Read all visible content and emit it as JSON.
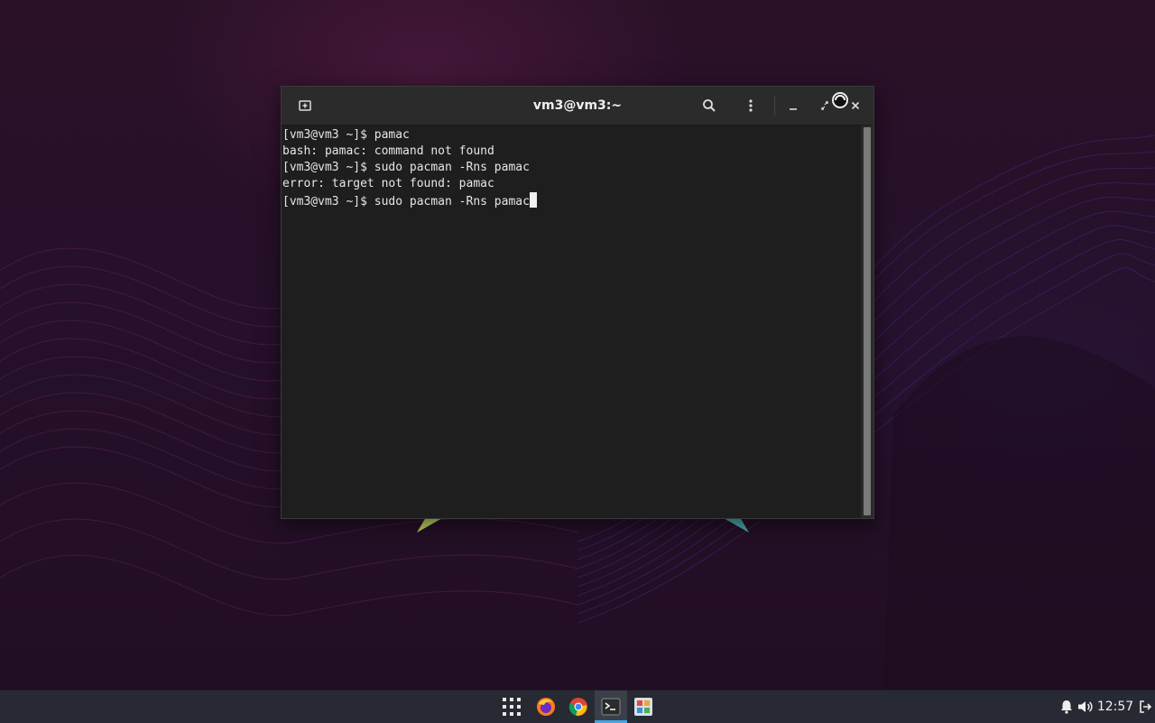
{
  "window": {
    "title": "vm3@vm3:~",
    "new_tab_icon": "new-tab-icon",
    "search_icon": "search-icon",
    "menu_icon": "kebab-menu-icon",
    "minimize_icon": "minimize-icon",
    "maximize_icon": "maximize-icon",
    "close_icon": "close-icon"
  },
  "terminal": {
    "lines": [
      "[vm3@vm3 ~]$ pamac",
      "bash: pamac: command not found",
      "[vm3@vm3 ~]$ sudo pacman -Rns pamac",
      "error: target not found: pamac",
      "[vm3@vm3 ~]$ sudo pacman -Rns pamac"
    ]
  },
  "taskbar": {
    "apps": [
      {
        "name": "app-grid",
        "icon": "app-grid-icon"
      },
      {
        "name": "firefox",
        "icon": "firefox-icon"
      },
      {
        "name": "chrome",
        "icon": "chrome-icon"
      },
      {
        "name": "terminal",
        "icon": "terminal-icon",
        "active": true
      },
      {
        "name": "software-center",
        "icon": "software-center-icon"
      }
    ],
    "tray": {
      "notification_icon": "bell-icon",
      "volume_icon": "speaker-icon",
      "clock": "12:57",
      "logout_icon": "logout-icon"
    },
    "accent_color": "#4aa3df"
  },
  "colors": {
    "desktop_bg": "#26102a",
    "terminal_bg": "#1e1e1e",
    "titlebar_bg": "#2b2b2b",
    "taskbar_bg": "#272a32"
  }
}
